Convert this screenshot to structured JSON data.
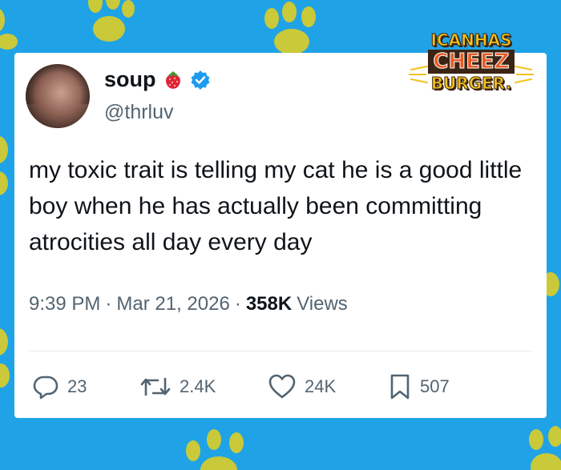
{
  "tweet": {
    "display_name": "soup",
    "name_emoji": "strawberry-icon",
    "verified_icon": "verified-badge-icon",
    "handle": "@thrluv",
    "text": "my toxic trait is telling my cat he is a good little boy when he has actually been committing atrocities all day every day",
    "time": "9:39 PM",
    "date": "Mar 21, 2026",
    "separator": "·",
    "views_count": "358K",
    "views_label": "Views"
  },
  "actions": {
    "replies": "23",
    "retweets": "2.4K",
    "likes": "24K",
    "bookmarks": "507"
  },
  "logo": {
    "line1": "ICANHAS",
    "line2": "CHEEZ",
    "line3": "BURGER."
  },
  "colors": {
    "background": "#1fa3e6",
    "paw": "#c9c93a",
    "verified": "#1d9bf0",
    "logo_yellow": "#f4c21b",
    "logo_orange": "#e85a24"
  }
}
